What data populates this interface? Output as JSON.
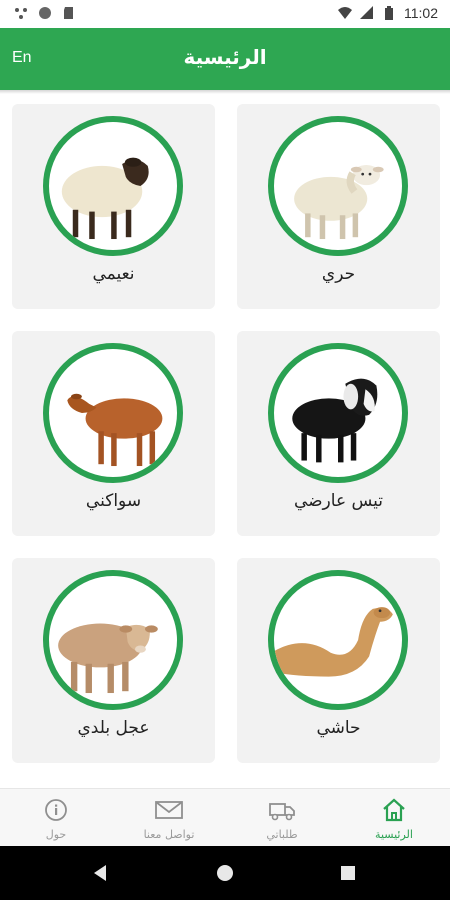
{
  "status_bar": {
    "time": "11:02"
  },
  "app_bar": {
    "lang_button": "En",
    "title": "الرئيسية"
  },
  "products": [
    {
      "label": "حري",
      "animal": "white-sheep"
    },
    {
      "label": "نعيمي",
      "animal": "naimi-sheep"
    },
    {
      "label": "تيس عارضي",
      "animal": "black-goat"
    },
    {
      "label": "سواكني",
      "animal": "brown-sheep"
    },
    {
      "label": "حاشي",
      "animal": "camel"
    },
    {
      "label": "عجل بلدي",
      "animal": "calf"
    }
  ],
  "bottom_nav": {
    "items": [
      {
        "label": "الرئيسية",
        "icon": "home-icon",
        "active": true
      },
      {
        "label": "طلباتي",
        "icon": "truck-icon",
        "active": false
      },
      {
        "label": "تواصل معنا",
        "icon": "mail-icon",
        "active": false
      },
      {
        "label": "حول",
        "icon": "info-icon",
        "active": false
      }
    ]
  },
  "colors": {
    "primary": "#2ea752",
    "ring": "#2aa152",
    "card_bg": "#f2f2f2"
  }
}
